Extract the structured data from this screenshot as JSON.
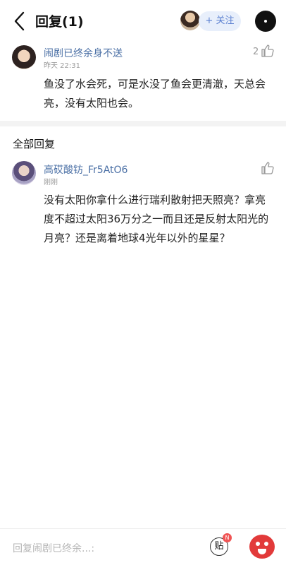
{
  "header": {
    "title": "回复(1)",
    "follow_label": "+ 关注"
  },
  "post": {
    "author": "闹剧已终余身不送",
    "time": "昨天 22:31",
    "likes": "2",
    "content_line1": "鱼没了水会死，可是水没了鱼会更清澈，天总会",
    "content_line2": "亮，没有太阳也会。"
  },
  "section": {
    "title": "全部回复"
  },
  "reply": {
    "author": "高砹酸钫_Fr5AtO6",
    "time": "刚刚",
    "content_line1": "没有太阳你拿什么进行瑞利散射把天照亮？拿亮",
    "content_line2": "度不超过太阳36万分之一而且还是反射太阳光的",
    "content_line3": "月亮？还是离着地球4光年以外的星星？"
  },
  "bottombar": {
    "input_placeholder": "回复闹剧已终余...:",
    "tie_label": "贴",
    "badge": "N"
  },
  "colors": {
    "accent": "#4a6fa5",
    "follow_bg": "#e8effb",
    "follow_text": "#5a7fd0",
    "badge": "#f05454",
    "emoji": "#e23a3a"
  },
  "icons": [
    "back-icon",
    "thumb-up-icon",
    "more-icon",
    "tie-icon",
    "emoji-icon"
  ]
}
